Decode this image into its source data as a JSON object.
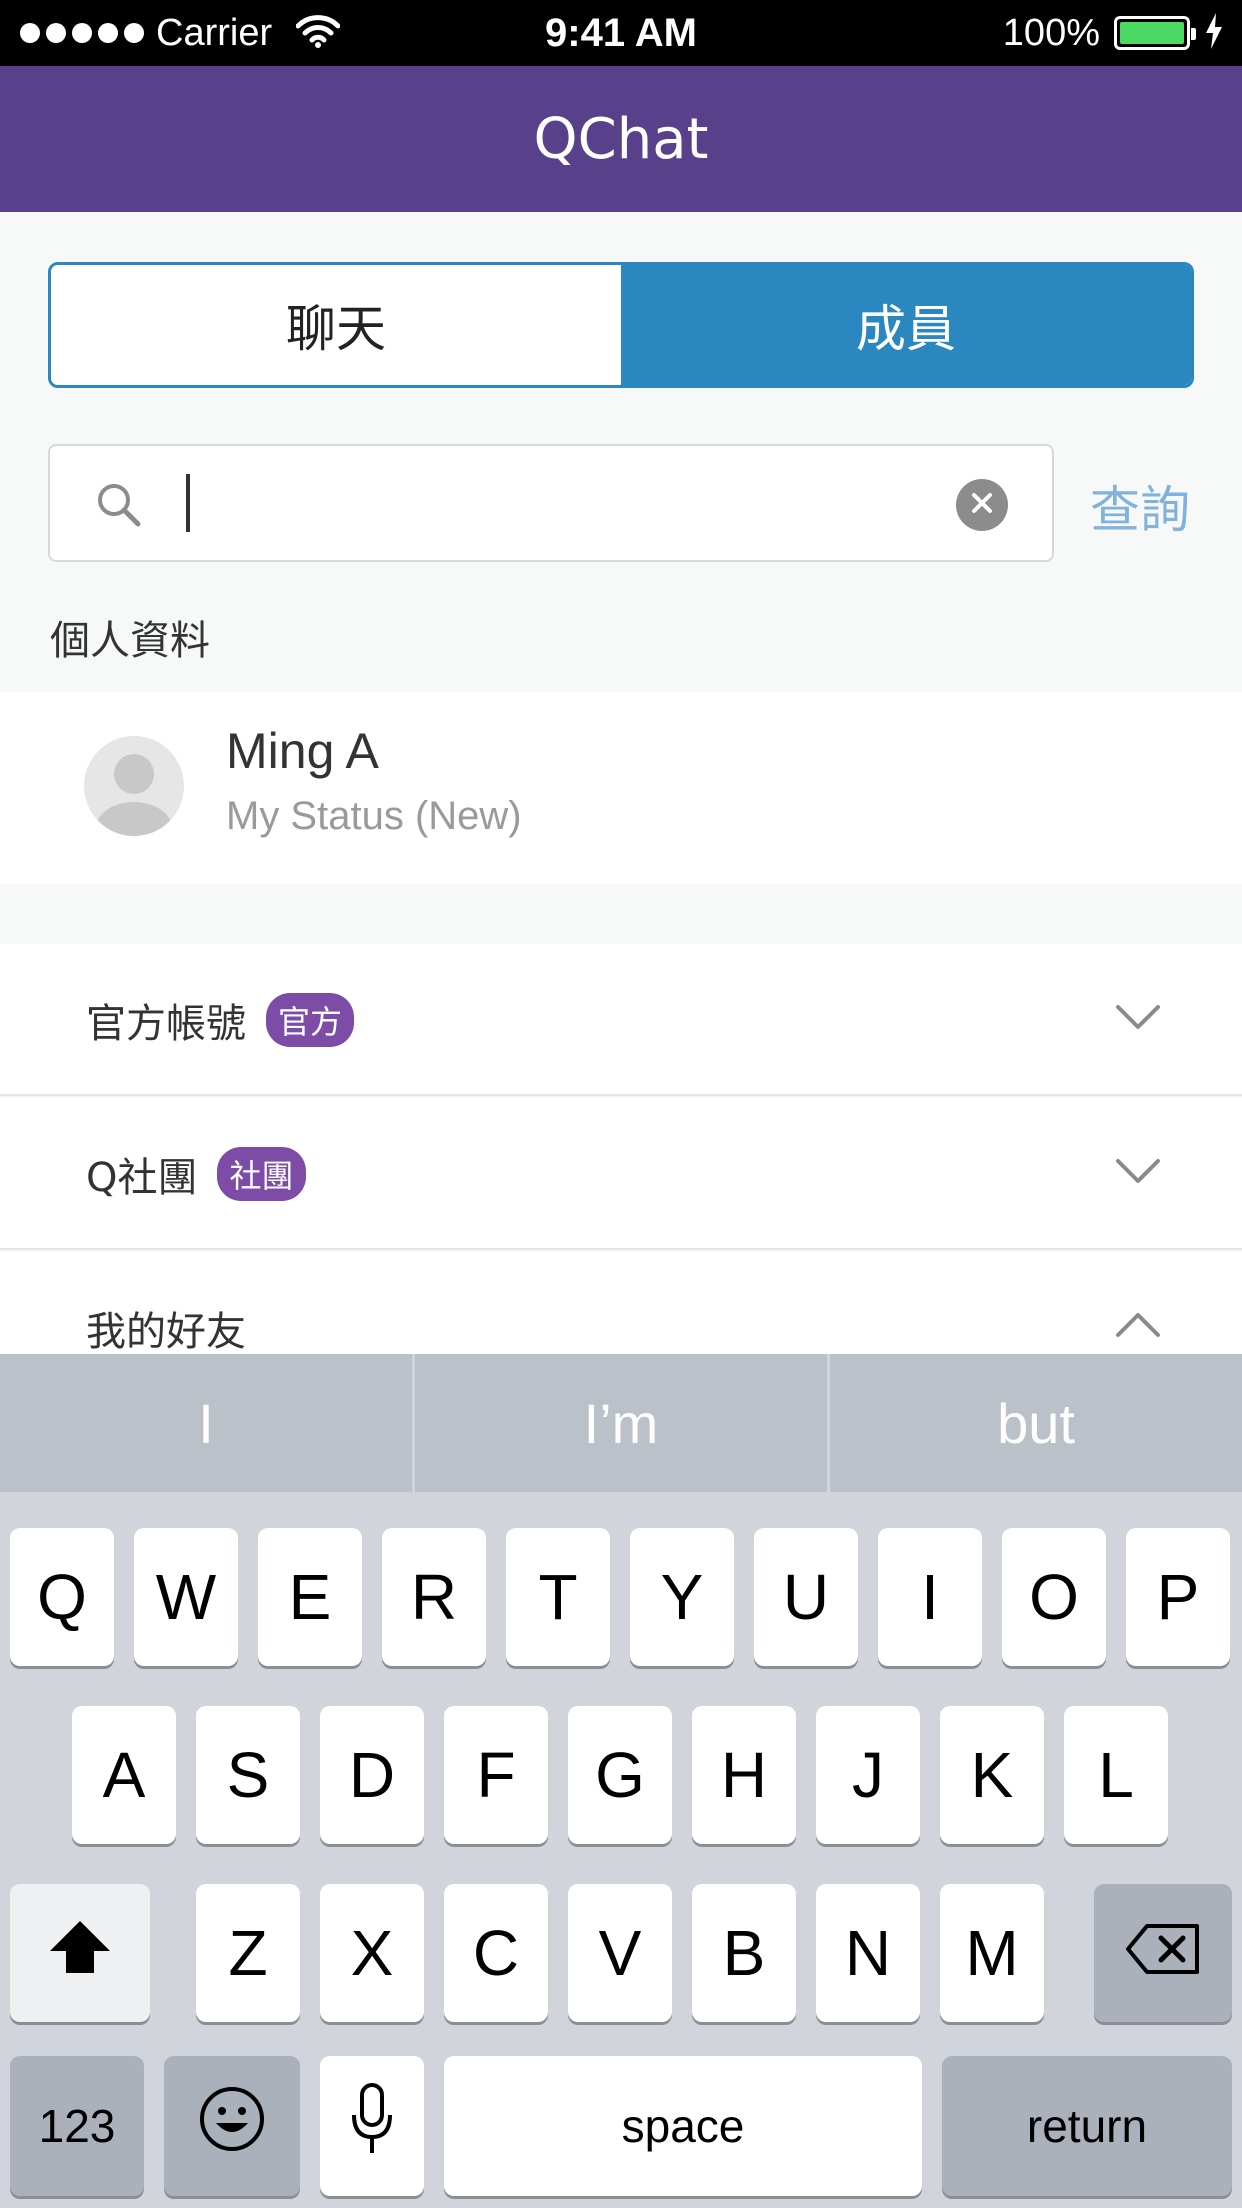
{
  "status_bar": {
    "carrier": "Carrier",
    "time": "9:41 AM",
    "battery": "100%"
  },
  "nav": {
    "title": "QChat"
  },
  "tabs": [
    {
      "label": "聊天",
      "selected": false
    },
    {
      "label": "成員",
      "selected": true
    }
  ],
  "search": {
    "placeholder": "",
    "value": "",
    "button_label": "查詢"
  },
  "profile_section": {
    "label": "個人資料",
    "name": "Ming A",
    "status": "My Status (New)"
  },
  "groups": [
    {
      "label": "官方帳號",
      "badge": "官方",
      "expanded": false
    },
    {
      "label": "Q社團",
      "badge": "社團",
      "expanded": false
    },
    {
      "label": "我的好友",
      "badge": "",
      "expanded": true
    }
  ],
  "keyboard": {
    "suggestions": [
      "I",
      "I’m",
      "but"
    ],
    "row1": [
      "Q",
      "W",
      "E",
      "R",
      "T",
      "Y",
      "U",
      "I",
      "O",
      "P"
    ],
    "row2": [
      "A",
      "S",
      "D",
      "F",
      "G",
      "H",
      "J",
      "K",
      "L"
    ],
    "row3": [
      "Z",
      "X",
      "C",
      "V",
      "B",
      "N",
      "M"
    ],
    "numbers_label": "123",
    "space_label": "space",
    "return_label": "return"
  },
  "colors": {
    "nav": "#58418a",
    "tab_accent": "#2b87c0",
    "badge": "#7c4ca6",
    "search_button": "#7fb2dc"
  }
}
